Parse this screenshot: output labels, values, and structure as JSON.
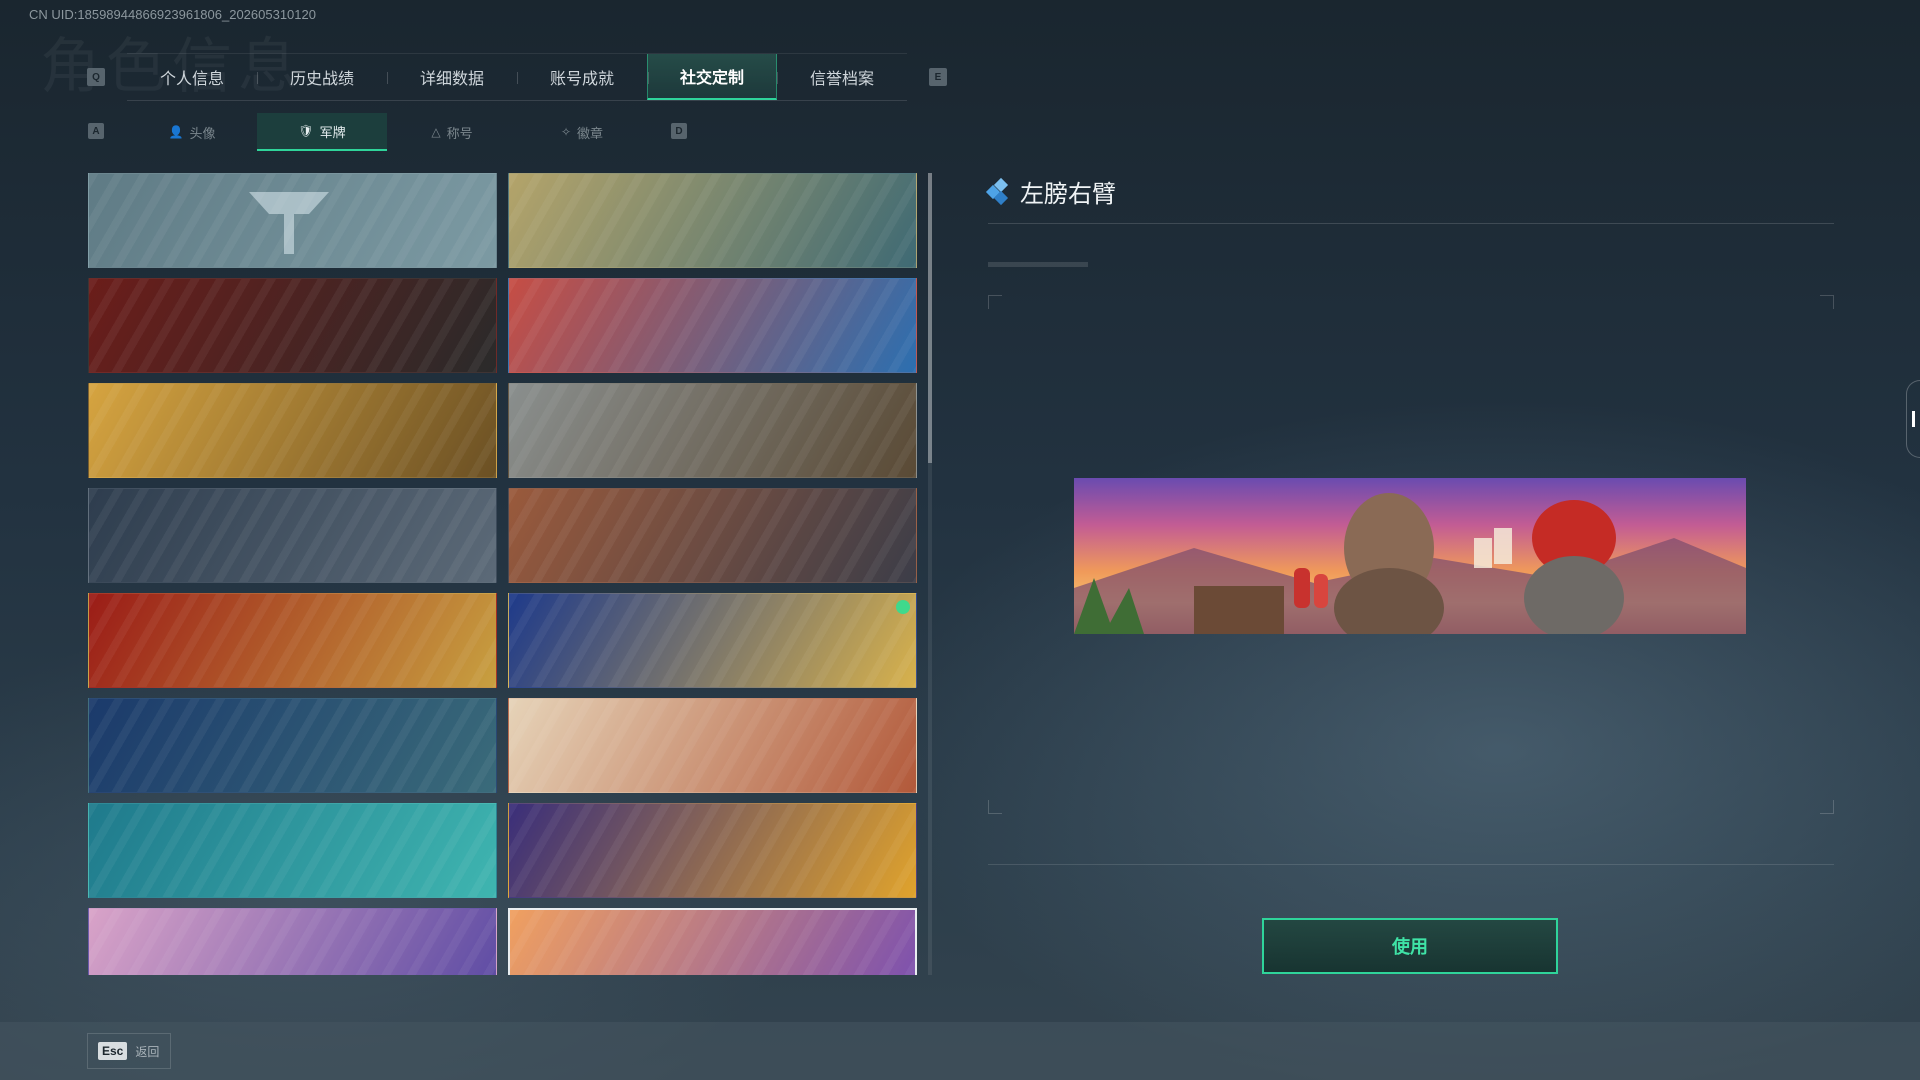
{
  "uid_text": "CN UID:185989448669239618​06_202605310120",
  "header": {
    "prev_key": "Q",
    "next_key": "E",
    "tabs": [
      {
        "label": "个人信息",
        "active": false
      },
      {
        "label": "历史战绩",
        "active": false
      },
      {
        "label": "详细数据",
        "active": false
      },
      {
        "label": "账号成就",
        "active": false
      },
      {
        "label": "社交定制",
        "active": true
      },
      {
        "label": "信誉档案",
        "active": false
      }
    ]
  },
  "subnav": {
    "prev_key": "A",
    "next_key": "D",
    "tabs": [
      {
        "label": "头像",
        "icon": "person-icon",
        "active": false
      },
      {
        "label": "军牌",
        "icon": "shield-emblem-icon",
        "active": true
      },
      {
        "label": "称号",
        "icon": "triangle-icon",
        "active": false
      },
      {
        "label": "徽章",
        "icon": "wing-badge-icon",
        "active": false
      }
    ]
  },
  "cards": [
    {
      "name": "default-emblem",
      "colors": [
        "#5f7b85",
        "#7c9aa3"
      ],
      "selected": false,
      "logo": true
    },
    {
      "name": "desert-gunsmith",
      "colors": [
        "#b4a46a",
        "#3f6a74"
      ],
      "selected": false
    },
    {
      "name": "red-squad",
      "colors": [
        "#6b1d1a",
        "#2a2a2a"
      ],
      "selected": false
    },
    {
      "name": "octopus-wave",
      "colors": [
        "#c64d44",
        "#2c6fb0"
      ],
      "selected": false
    },
    {
      "name": "feast-table",
      "colors": [
        "#d6a440",
        "#6b5024"
      ],
      "selected": false
    },
    {
      "name": "mountain-sniper",
      "colors": [
        "#8a8f8e",
        "#5a4a35"
      ],
      "selected": false
    },
    {
      "name": "stairway-assault",
      "colors": [
        "#2e3d4e",
        "#5c6a78"
      ],
      "selected": false
    },
    {
      "name": "party-dinner",
      "colors": [
        "#9a5a3c",
        "#3c3d48"
      ],
      "selected": false
    },
    {
      "name": "red-rose-dragon",
      "colors": [
        "#9b1c17",
        "#c8a040"
      ],
      "selected": false
    },
    {
      "name": "gold-jewel",
      "colors": [
        "#1e3a8a",
        "#d8b24c"
      ],
      "selected": false,
      "badge": true
    },
    {
      "name": "blue-phoenix",
      "colors": [
        "#1b3a6b",
        "#3a6b7a"
      ],
      "selected": false
    },
    {
      "name": "chibi-celebration",
      "colors": [
        "#e6d3b8",
        "#b2593a"
      ],
      "selected": false
    },
    {
      "name": "teal-seascape",
      "colors": [
        "#1f7a8c",
        "#3fb5b0"
      ],
      "selected": false
    },
    {
      "name": "carnival-smile",
      "colors": [
        "#3a2e7a",
        "#e0a32c"
      ],
      "selected": false
    },
    {
      "name": "pink-roses",
      "colors": [
        "#d9a3c8",
        "#5b4aa3"
      ],
      "selected": false
    },
    {
      "name": "sunset-duo",
      "colors": [
        "#f0a060",
        "#7a4fb0"
      ],
      "selected": true
    }
  ],
  "detail": {
    "title": "左膀右臂",
    "use_label": "使用"
  },
  "footer": {
    "esc_key": "Esc",
    "esc_label": "返回"
  }
}
